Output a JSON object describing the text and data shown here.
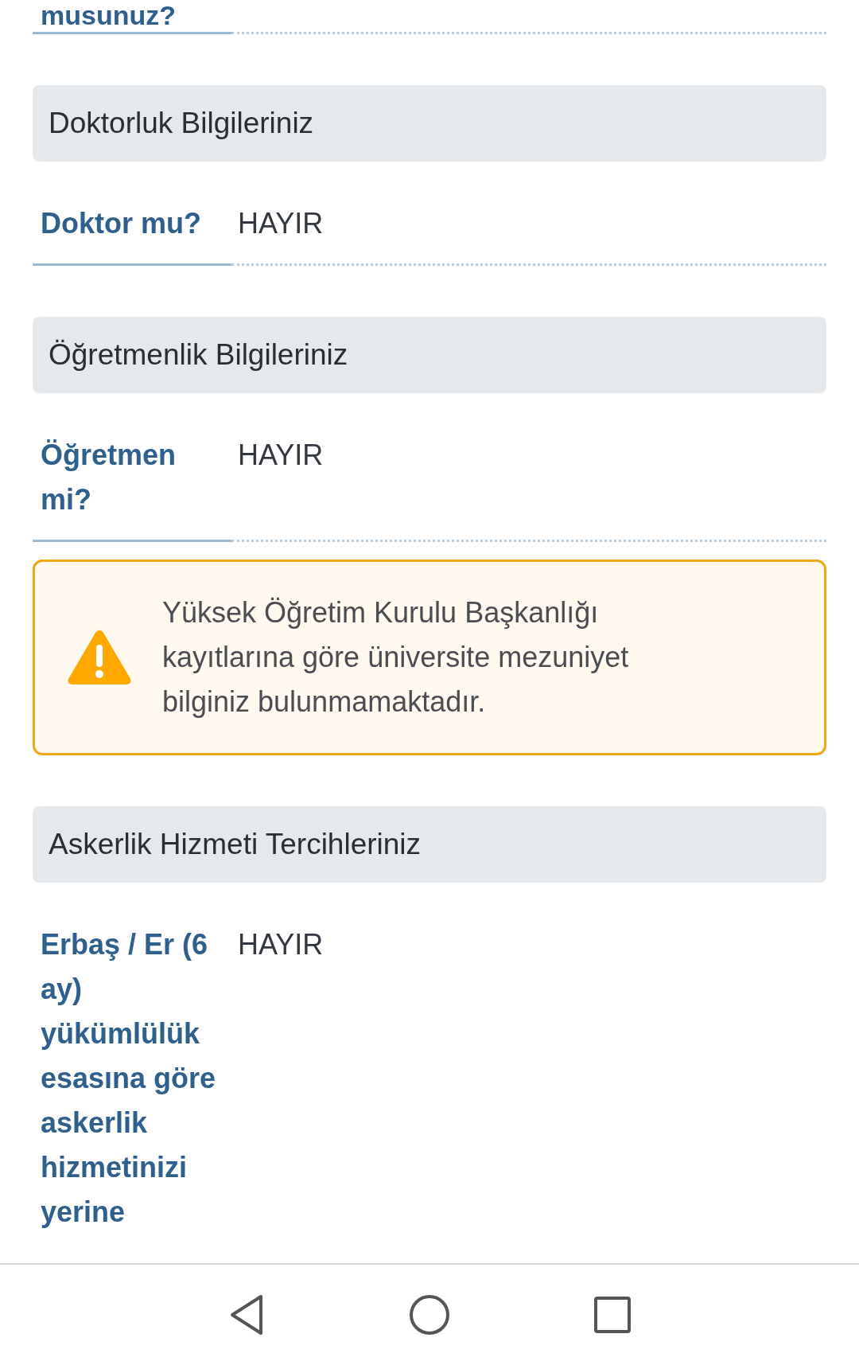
{
  "sections": [
    {
      "kind": "field_row",
      "label": "musunuz?"
    },
    {
      "kind": "header",
      "title": "Doktorluk Bilgileriniz"
    },
    {
      "kind": "field_row",
      "label": "Doktor mu?",
      "value": "HAYIR"
    },
    {
      "kind": "header",
      "title": "Öğretmenlik Bilgileriniz"
    },
    {
      "kind": "field_row",
      "label": "Öğretmen mi?",
      "value": "HAYIR"
    },
    {
      "kind": "warning",
      "text": "Yüksek Öğretim Kurulu Başkanlığı kayıtlarına göre üniversite mezuniyet bilginiz bulunmamaktadır."
    },
    {
      "kind": "header",
      "title": "Askerlik Hizmeti Tercihleriniz"
    },
    {
      "kind": "field_row",
      "label": "Erbaş / Er (6 ay) yükümlülük esasına göre askerlik hizmetinizi yerine",
      "value": "HAYIR"
    }
  ],
  "nav_bar": {
    "buttons": [
      {
        "kind": "back"
      },
      {
        "kind": "home"
      },
      {
        "kind": "recents"
      }
    ]
  }
}
